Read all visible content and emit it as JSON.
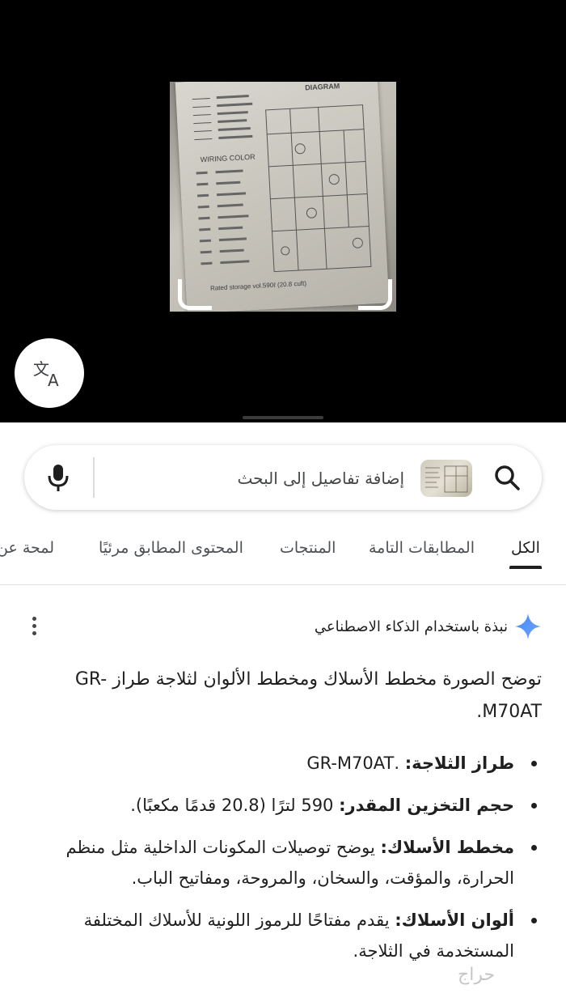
{
  "viewer": {
    "photo": {
      "diagram_title": "DIAGRAM",
      "wiring_color_label": "WIRING COLOR",
      "rated_storage": "Rated storage vol.590ℓ (20.8 cuft)"
    },
    "translate_icon": "translate-icon"
  },
  "search": {
    "placeholder": "إضافة تفاصيل إلى البحث",
    "mic_icon": "mic-icon",
    "search_icon": "search-icon"
  },
  "tabs": [
    {
      "label": "الكل",
      "active": true
    },
    {
      "label": "المطابقات التامة"
    },
    {
      "label": "المنتجات"
    },
    {
      "label": "المحتوى المطابق مرئيًا"
    },
    {
      "label": "لمحة عن"
    }
  ],
  "ai_overview": {
    "title": "نبذة باستخدام الذكاء الاصطناعي",
    "intro": "توضح الصورة مخطط الأسلاك ومخطط الألوان لثلاجة طراز GR-M70AT.",
    "bullets": [
      {
        "label": "طراز الثلاجة:",
        "text": " .GR-M70AT"
      },
      {
        "label": "حجم التخزين المقدر:",
        "text": " 590 لترًا (20.8 قدمًا مكعبًا)."
      },
      {
        "label": "مخطط الأسلاك:",
        "text": " يوضح توصيلات المكونات الداخلية مثل منظم الحرارة، والمؤقت، والسخان، والمروحة، ومفاتيح الباب."
      },
      {
        "label": "ألوان الأسلاك:",
        "text": " يقدم مفتاحًا للرموز اللونية للأسلاك المختلفة المستخدمة في الثلاجة."
      }
    ]
  },
  "colors": {
    "accent_star": "#4285f4",
    "text": "#1f1f1f",
    "muted": "#4d5156"
  }
}
